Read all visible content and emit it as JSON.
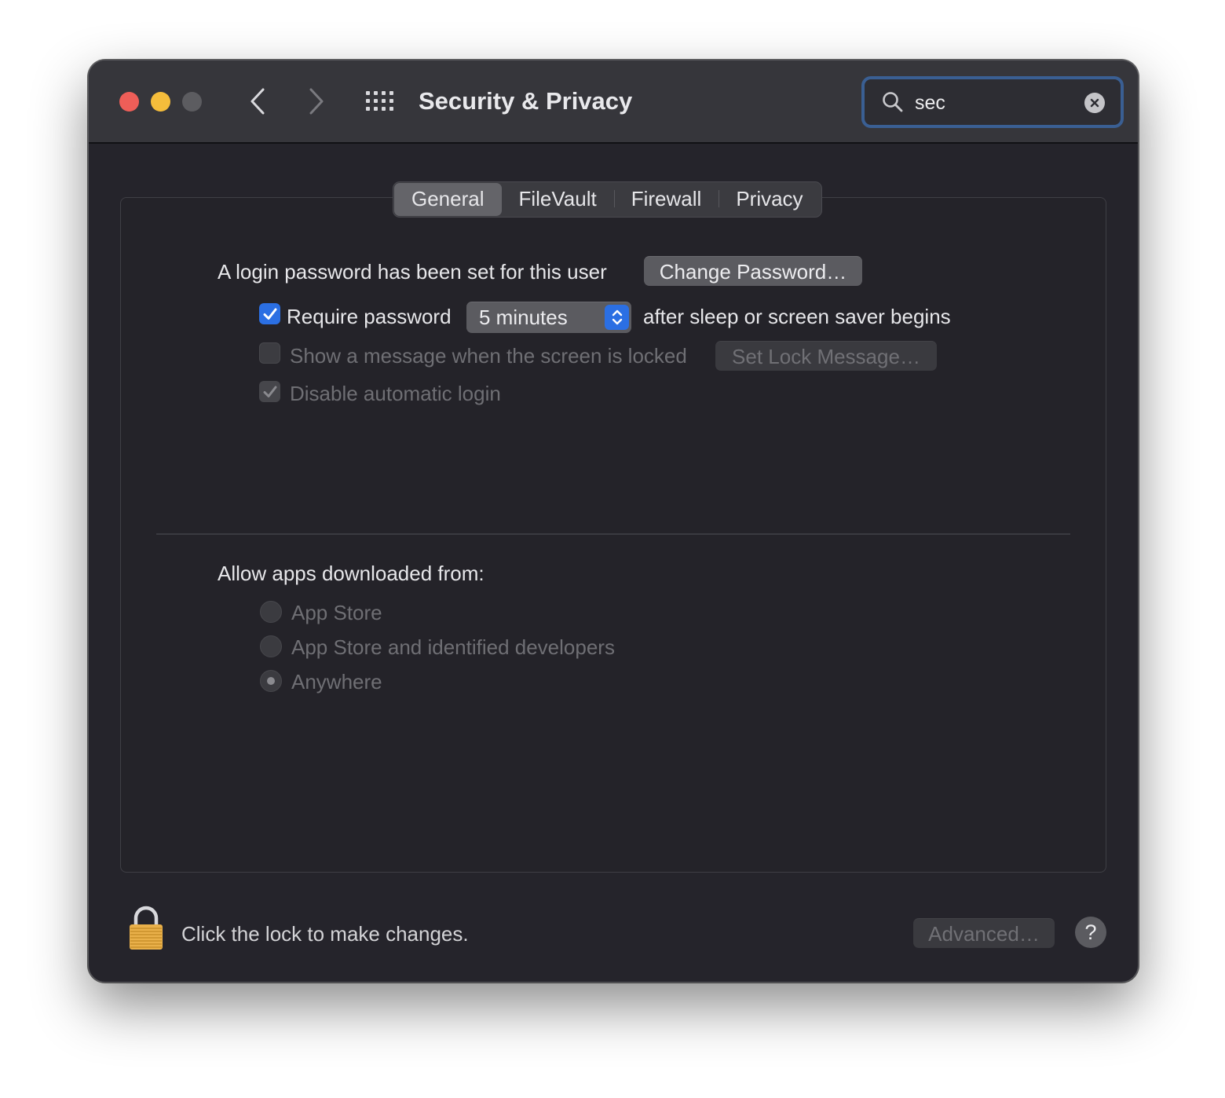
{
  "window": {
    "title": "Security & Privacy",
    "search": {
      "value": "sec",
      "placeholder": "Search"
    }
  },
  "tabs": [
    {
      "label": "General",
      "active": true
    },
    {
      "label": "FileVault",
      "active": false
    },
    {
      "label": "Firewall",
      "active": false
    },
    {
      "label": "Privacy",
      "active": false
    }
  ],
  "general": {
    "login_text": "A login password has been set for this user",
    "change_password_label": "Change Password…",
    "require_password": {
      "label": "Require password",
      "checked": true,
      "delay_value": "5 minutes",
      "suffix": "after sleep or screen saver begins"
    },
    "show_message": {
      "label": "Show a message when the screen is locked",
      "checked": false,
      "enabled": false,
      "button_label": "Set Lock Message…"
    },
    "disable_auto_login": {
      "label": "Disable automatic login",
      "checked": true,
      "enabled": false
    },
    "allow_apps": {
      "heading": "Allow apps downloaded from:",
      "options": [
        {
          "label": "App Store",
          "selected": false
        },
        {
          "label": "App Store and identified developers",
          "selected": false
        },
        {
          "label": "Anywhere",
          "selected": true
        }
      ]
    }
  },
  "footer": {
    "lock_text": "Click the lock to make changes.",
    "advanced_label": "Advanced…",
    "help_label": "?"
  },
  "colors": {
    "accent": "#2b6fe3",
    "close": "#ee5e58",
    "minimize": "#f5bd3b",
    "zoom_disabled": "#5c5c60",
    "search_focus": "#3a5f93"
  },
  "icons": {
    "back": "chevron-left-icon",
    "forward": "chevron-right-icon",
    "grid": "grid-icon",
    "search": "search-icon",
    "clear": "clear-icon",
    "lock": "lock-icon",
    "help": "help-icon"
  }
}
